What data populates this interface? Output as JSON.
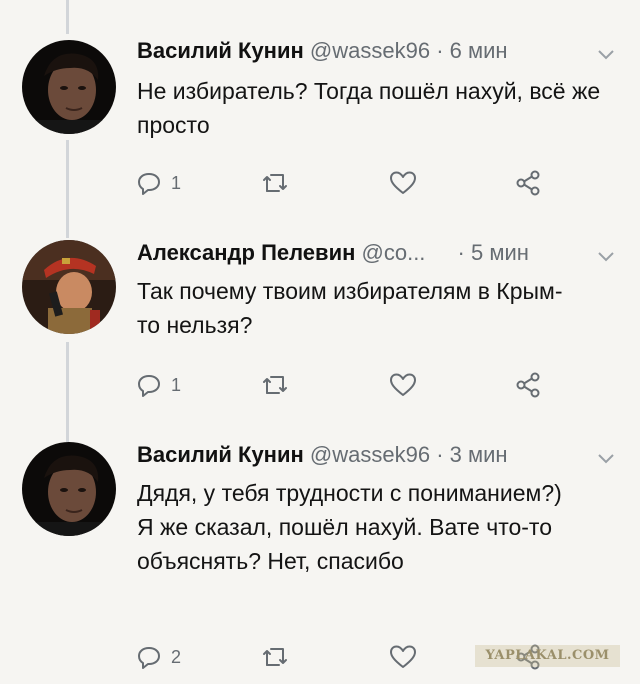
{
  "tweets": [
    {
      "name": "Василий Кунин",
      "handle": "@wassek96",
      "separator": "·",
      "time": "6 мин",
      "text": "Не избиратель? Тогда пошёл нахуй, всё же просто",
      "reply_count": "1",
      "retweet_count": "",
      "like_count": ""
    },
    {
      "name": "Александр Пелевин",
      "handle": "@co...",
      "separator": "·",
      "time": "5 мин",
      "text": "Так почему твоим избирателям в Крым-то нельзя?",
      "reply_count": "1",
      "retweet_count": "",
      "like_count": ""
    },
    {
      "name": "Василий Кунин",
      "handle": "@wassek96",
      "separator": "·",
      "time": "3 мин",
      "text": "Дядя, у тебя трудности с пониманием?) Я же сказал, пошёл нахуй. Вате что-то объяснять? Нет, спасибо",
      "reply_count": "2",
      "retweet_count": "",
      "like_count": ""
    }
  ],
  "watermark": "YAPLAKAL.COM",
  "icons": {
    "reply": "reply-icon",
    "retweet": "retweet-icon",
    "like": "heart-icon",
    "share": "share-icon",
    "menu": "chevron-down-icon"
  },
  "colors": {
    "background": "#f6f5f2",
    "muted_text": "#666c72",
    "thread_line": "#d2d5d9"
  }
}
